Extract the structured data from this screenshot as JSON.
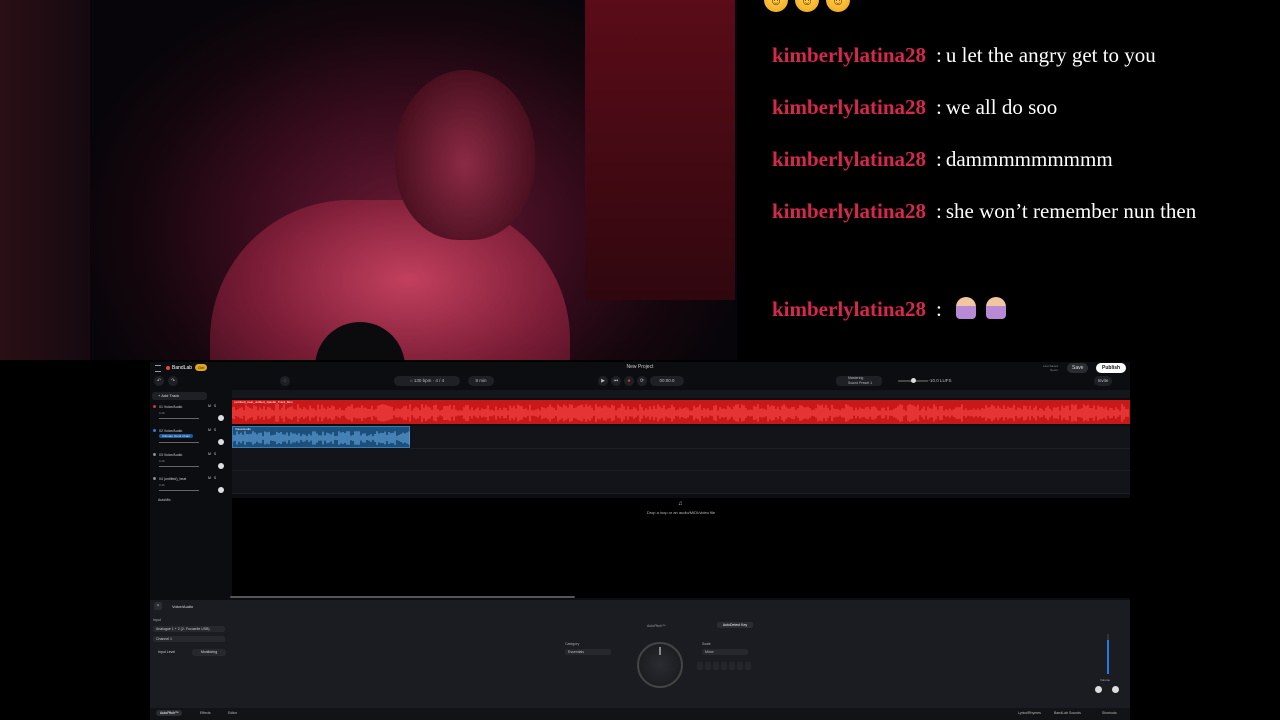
{
  "chat": {
    "emoji_row": [
      "grinning-face",
      "grinning-face",
      "grinning-face"
    ],
    "username_color": "#d6284c",
    "messages": [
      {
        "user": "kimberlylatina28",
        "text": "u let the angry get to you"
      },
      {
        "user": "kimberlylatina28",
        "text": "we all do soo"
      },
      {
        "user": "kimberlylatina28",
        "text": "dammmmmmmmm"
      },
      {
        "user": "kimberlylatina28",
        "text": "she won’t remember nun then"
      },
      {
        "user": "kimberlylatina28",
        "text": ""
      }
    ]
  },
  "daw": {
    "app_name": "BandLab",
    "get_pill": "Get",
    "project_title": "New Project",
    "last_saved": "Last Saved",
    "last_saved_value": "Never",
    "save_label": "Save",
    "publish_label": "Publish",
    "tempo": "130",
    "tempo_unit": "bpm",
    "time_sig": "4 / 4",
    "key": "4",
    "duration": "8 min",
    "time_display": "00:00.0",
    "mastering_label": "Mastering",
    "mastering_sub": "Sound Preset 1",
    "zoom": "-10.0 LUFS",
    "invite_label": "Invite",
    "add_track": "Add Track",
    "tracks": [
      {
        "num": "01",
        "name": "Voice/Audio",
        "sub": "0 db",
        "color": "#e03030"
      },
      {
        "num": "02",
        "name": "Voice/Audio",
        "sub": "0 db",
        "preset": "Ultimate Vocal Chain",
        "color": "#2a7ae2"
      },
      {
        "num": "03",
        "name": "Voice/Audio",
        "sub": "0 db",
        "color": "#8a8a8a"
      },
      {
        "num": "04",
        "name": "(untitled)_beat",
        "sub": "0 db",
        "color": "#8a8a8a"
      }
    ],
    "autotune_label": "AutoMix",
    "red_clip_label": "(untitled)_beat_untitled_1(audio_Track_Mix)",
    "blue_clip_label": "Voice/Audio",
    "drop_text": "Drop a loop or an audio/MIDI/video file",
    "bottom": {
      "title": "Voice/Audio",
      "input_label": "Input",
      "device": "Analogue 1 + 2 (2- Focusrite USB)",
      "channel": "Channel 1",
      "input_level": "Input Level",
      "monitoring": "Monitoring",
      "autopitch": "AutoPitch™",
      "autodetect": "AutoDetect Key",
      "category_label": "Category",
      "category_value": "Essentials",
      "scale_label": "Scale",
      "scale_value": "Minor",
      "volume_label": "Volume",
      "footer_tabs": [
        "AutoPitch™",
        "Effects",
        "Editor"
      ],
      "footer_right": [
        "LyricsIRhymes",
        "BandLab Sounds",
        "Shortcuts"
      ]
    },
    "clip_red_color": "#c81818",
    "clip_blue_color": "#1c4f7a"
  }
}
